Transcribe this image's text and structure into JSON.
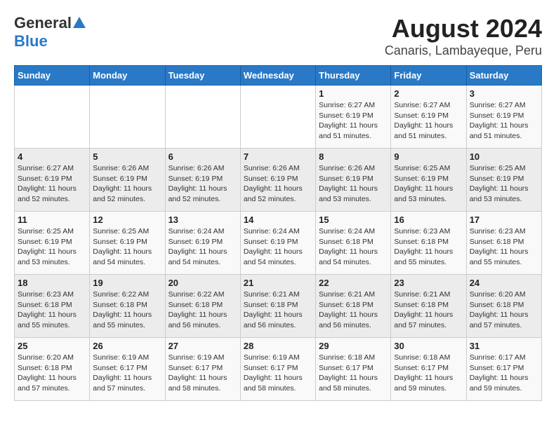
{
  "header": {
    "logo_line1": "General",
    "logo_line2": "Blue",
    "title": "August 2024",
    "subtitle": "Canaris, Lambayeque, Peru"
  },
  "calendar": {
    "days_of_week": [
      "Sunday",
      "Monday",
      "Tuesday",
      "Wednesday",
      "Thursday",
      "Friday",
      "Saturday"
    ],
    "weeks": [
      [
        {
          "day": "",
          "info": ""
        },
        {
          "day": "",
          "info": ""
        },
        {
          "day": "",
          "info": ""
        },
        {
          "day": "",
          "info": ""
        },
        {
          "day": "1",
          "info": "Sunrise: 6:27 AM\nSunset: 6:19 PM\nDaylight: 11 hours\nand 51 minutes."
        },
        {
          "day": "2",
          "info": "Sunrise: 6:27 AM\nSunset: 6:19 PM\nDaylight: 11 hours\nand 51 minutes."
        },
        {
          "day": "3",
          "info": "Sunrise: 6:27 AM\nSunset: 6:19 PM\nDaylight: 11 hours\nand 51 minutes."
        }
      ],
      [
        {
          "day": "4",
          "info": "Sunrise: 6:27 AM\nSunset: 6:19 PM\nDaylight: 11 hours\nand 52 minutes."
        },
        {
          "day": "5",
          "info": "Sunrise: 6:26 AM\nSunset: 6:19 PM\nDaylight: 11 hours\nand 52 minutes."
        },
        {
          "day": "6",
          "info": "Sunrise: 6:26 AM\nSunset: 6:19 PM\nDaylight: 11 hours\nand 52 minutes."
        },
        {
          "day": "7",
          "info": "Sunrise: 6:26 AM\nSunset: 6:19 PM\nDaylight: 11 hours\nand 52 minutes."
        },
        {
          "day": "8",
          "info": "Sunrise: 6:26 AM\nSunset: 6:19 PM\nDaylight: 11 hours\nand 53 minutes."
        },
        {
          "day": "9",
          "info": "Sunrise: 6:25 AM\nSunset: 6:19 PM\nDaylight: 11 hours\nand 53 minutes."
        },
        {
          "day": "10",
          "info": "Sunrise: 6:25 AM\nSunset: 6:19 PM\nDaylight: 11 hours\nand 53 minutes."
        }
      ],
      [
        {
          "day": "11",
          "info": "Sunrise: 6:25 AM\nSunset: 6:19 PM\nDaylight: 11 hours\nand 53 minutes."
        },
        {
          "day": "12",
          "info": "Sunrise: 6:25 AM\nSunset: 6:19 PM\nDaylight: 11 hours\nand 54 minutes."
        },
        {
          "day": "13",
          "info": "Sunrise: 6:24 AM\nSunset: 6:19 PM\nDaylight: 11 hours\nand 54 minutes."
        },
        {
          "day": "14",
          "info": "Sunrise: 6:24 AM\nSunset: 6:19 PM\nDaylight: 11 hours\nand 54 minutes."
        },
        {
          "day": "15",
          "info": "Sunrise: 6:24 AM\nSunset: 6:18 PM\nDaylight: 11 hours\nand 54 minutes."
        },
        {
          "day": "16",
          "info": "Sunrise: 6:23 AM\nSunset: 6:18 PM\nDaylight: 11 hours\nand 55 minutes."
        },
        {
          "day": "17",
          "info": "Sunrise: 6:23 AM\nSunset: 6:18 PM\nDaylight: 11 hours\nand 55 minutes."
        }
      ],
      [
        {
          "day": "18",
          "info": "Sunrise: 6:23 AM\nSunset: 6:18 PM\nDaylight: 11 hours\nand 55 minutes."
        },
        {
          "day": "19",
          "info": "Sunrise: 6:22 AM\nSunset: 6:18 PM\nDaylight: 11 hours\nand 55 minutes."
        },
        {
          "day": "20",
          "info": "Sunrise: 6:22 AM\nSunset: 6:18 PM\nDaylight: 11 hours\nand 56 minutes."
        },
        {
          "day": "21",
          "info": "Sunrise: 6:21 AM\nSunset: 6:18 PM\nDaylight: 11 hours\nand 56 minutes."
        },
        {
          "day": "22",
          "info": "Sunrise: 6:21 AM\nSunset: 6:18 PM\nDaylight: 11 hours\nand 56 minutes."
        },
        {
          "day": "23",
          "info": "Sunrise: 6:21 AM\nSunset: 6:18 PM\nDaylight: 11 hours\nand 57 minutes."
        },
        {
          "day": "24",
          "info": "Sunrise: 6:20 AM\nSunset: 6:18 PM\nDaylight: 11 hours\nand 57 minutes."
        }
      ],
      [
        {
          "day": "25",
          "info": "Sunrise: 6:20 AM\nSunset: 6:18 PM\nDaylight: 11 hours\nand 57 minutes."
        },
        {
          "day": "26",
          "info": "Sunrise: 6:19 AM\nSunset: 6:17 PM\nDaylight: 11 hours\nand 57 minutes."
        },
        {
          "day": "27",
          "info": "Sunrise: 6:19 AM\nSunset: 6:17 PM\nDaylight: 11 hours\nand 58 minutes."
        },
        {
          "day": "28",
          "info": "Sunrise: 6:19 AM\nSunset: 6:17 PM\nDaylight: 11 hours\nand 58 minutes."
        },
        {
          "day": "29",
          "info": "Sunrise: 6:18 AM\nSunset: 6:17 PM\nDaylight: 11 hours\nand 58 minutes."
        },
        {
          "day": "30",
          "info": "Sunrise: 6:18 AM\nSunset: 6:17 PM\nDaylight: 11 hours\nand 59 minutes."
        },
        {
          "day": "31",
          "info": "Sunrise: 6:17 AM\nSunset: 6:17 PM\nDaylight: 11 hours\nand 59 minutes."
        }
      ]
    ]
  }
}
